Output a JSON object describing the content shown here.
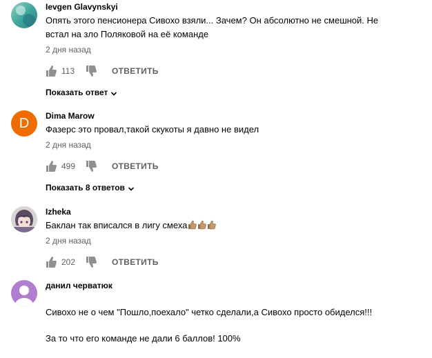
{
  "comments": [
    {
      "author": "Ievgen Glavynskyi",
      "avatar_icon": "avatar-gradient-icon",
      "text": "Опять этого пенсионера Сивохо взяли... Зачем? Он абсолютно не смешной. Не встал на зло Поляковой на её команде",
      "time": "2 дня назад",
      "likes": "113",
      "reply_label": "ОТВЕТИТЬ",
      "show_replies": "Показать ответ"
    },
    {
      "author": "Dima Marow",
      "avatar_letter": "D",
      "avatar_color": "#ef6c00",
      "text": "Фазерс это провал,такой скукоты я давно не видел",
      "time": "2 дня назад",
      "likes": "499",
      "reply_label": "ОТВЕТИТЬ",
      "show_replies": "Показать 8 ответов"
    },
    {
      "author": "Izheka",
      "avatar_icon": "anime-avatar-icon",
      "text": "Баклан так вписался в лигу смеха",
      "emoji_icon": "thumbs-up-emoji",
      "time": "2 дня назад",
      "likes": "202",
      "reply_label": "ОТВЕТИТЬ"
    },
    {
      "author": "данил черватюк",
      "avatar_icon": "default-user-avatar-icon",
      "avatar_color": "#b07ecf",
      "text_line1": "Сивохо не о чем \"Пошло,поехало\" четко сделали,а Сивохо просто обиделся!!!",
      "text_line2": "За то что его команде не дали 6 баллов! 100%"
    }
  ],
  "icons": {
    "like": "thumb-up-icon",
    "dislike": "thumb-down-icon",
    "expand": "chevron-down-icon"
  },
  "colors": {
    "text_primary": "#030303",
    "text_secondary": "#606060"
  }
}
